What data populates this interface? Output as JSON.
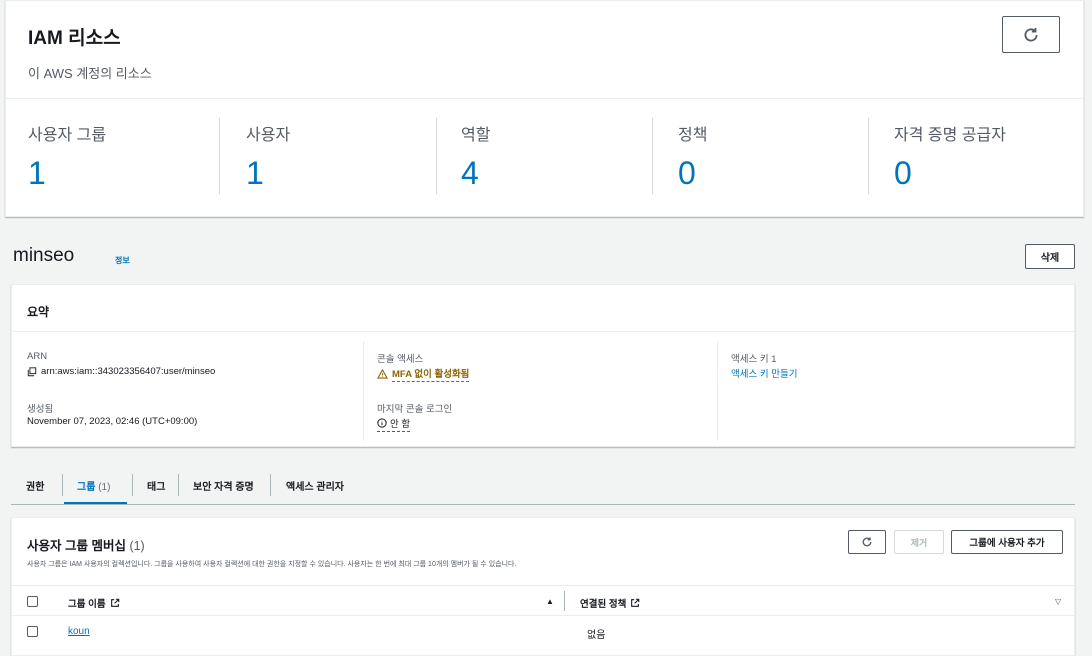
{
  "resources": {
    "title": "IAM 리소스",
    "subtitle": "이 AWS 계정의 리소스",
    "refresh_icon": "refresh-icon",
    "stats": [
      {
        "label": "사용자 그룹",
        "value": "1"
      },
      {
        "label": "사용자",
        "value": "1"
      },
      {
        "label": "역할",
        "value": "4"
      },
      {
        "label": "정책",
        "value": "0"
      },
      {
        "label": "자격 증명 공급자",
        "value": "0"
      }
    ]
  },
  "user": {
    "name": "minseo",
    "info_label": "정보",
    "delete_label": "삭제"
  },
  "summary": {
    "title": "요약",
    "arn_label": "ARN",
    "arn_value": "arn:aws:iam::343023356407:user/minseo",
    "created_label": "생성됨",
    "created_value": "November 07, 2023, 02:46 (UTC+09:00)",
    "console_access_label": "콘솔 액세스",
    "console_access_value": "MFA 없이 활성화됨",
    "last_login_label": "마지막 콘솔 로그인",
    "last_login_value": "안 함",
    "access_key_label": "액세스 키 1",
    "access_key_value": "액세스 키 만들기"
  },
  "tabs": [
    {
      "label": "권한",
      "count": ""
    },
    {
      "label": "그룹",
      "count": "(1)"
    },
    {
      "label": "태그",
      "count": ""
    },
    {
      "label": "보안 자격 증명",
      "count": ""
    },
    {
      "label": "액세스 관리자",
      "count": ""
    }
  ],
  "groups": {
    "title": "사용자 그룹 멤버십",
    "count": "(1)",
    "description": "사용자 그룹은 IAM 사용자의 컬렉션입니다. 그룹을 사용하여 사용자 컬렉션에 대한 권한을 지정할 수 있습니다. 사용자는 한 번에 최대 그룹 10개의 멤버가 될 수 있습니다.",
    "remove_label": "제거",
    "add_label": "그룹에 사용자 추가",
    "columns": [
      "그룹 이름",
      "연결된 정책"
    ],
    "rows": [
      {
        "name": "koun",
        "policy": "없음"
      }
    ]
  },
  "colors": {
    "link": "#0073bb",
    "warning": "#8d6605",
    "text": "#16191f",
    "muted": "#545b64"
  }
}
